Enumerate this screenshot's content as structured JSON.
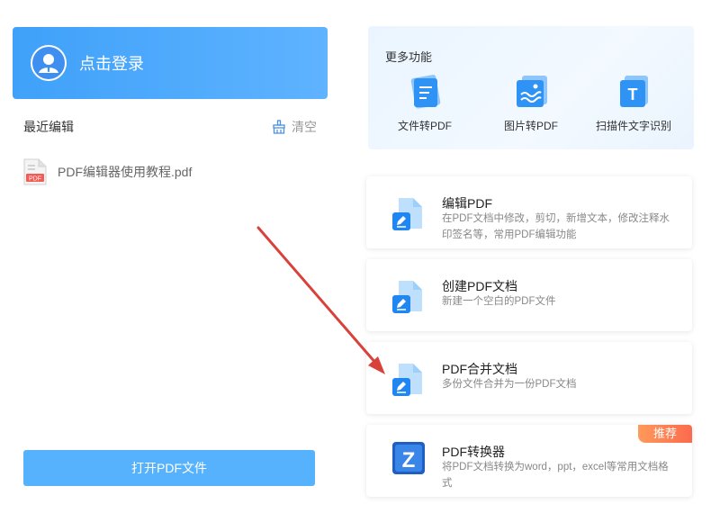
{
  "login": {
    "label": "点击登录"
  },
  "recent": {
    "title": "最近编辑",
    "clear_label": "清空",
    "files": [
      {
        "name": "PDF编辑器使用教程.pdf",
        "badge": "PDF"
      }
    ]
  },
  "open_button": {
    "label": "打开PDF文件"
  },
  "more": {
    "title": "更多功能",
    "items": [
      {
        "label": "文件转PDF",
        "icon": "file-to-pdf-icon"
      },
      {
        "label": "图片转PDF",
        "icon": "image-to-pdf-icon"
      },
      {
        "label": "扫描件文字识别",
        "icon": "ocr-icon",
        "glyph": "T"
      }
    ]
  },
  "cards": [
    {
      "title": "编辑PDF",
      "desc": "在PDF文档中修改，剪切，新增文本，修改注释水印签名等，常用PDF编辑功能"
    },
    {
      "title": "创建PDF文档",
      "desc": "新建一个空白的PDF文件"
    },
    {
      "title": "PDF合并文档",
      "desc": "多份文件合并为一份PDF文档"
    },
    {
      "title": "PDF转换器",
      "desc": "将PDF文档转换为word，ppt，excel等常用文档格式",
      "badge": "推荐",
      "glyph": "Z"
    }
  ],
  "colors": {
    "accent": "#3fa1f9",
    "open_button": "#56b2fc",
    "badge": "#fb6a4e",
    "arrow": "#d9413b"
  }
}
